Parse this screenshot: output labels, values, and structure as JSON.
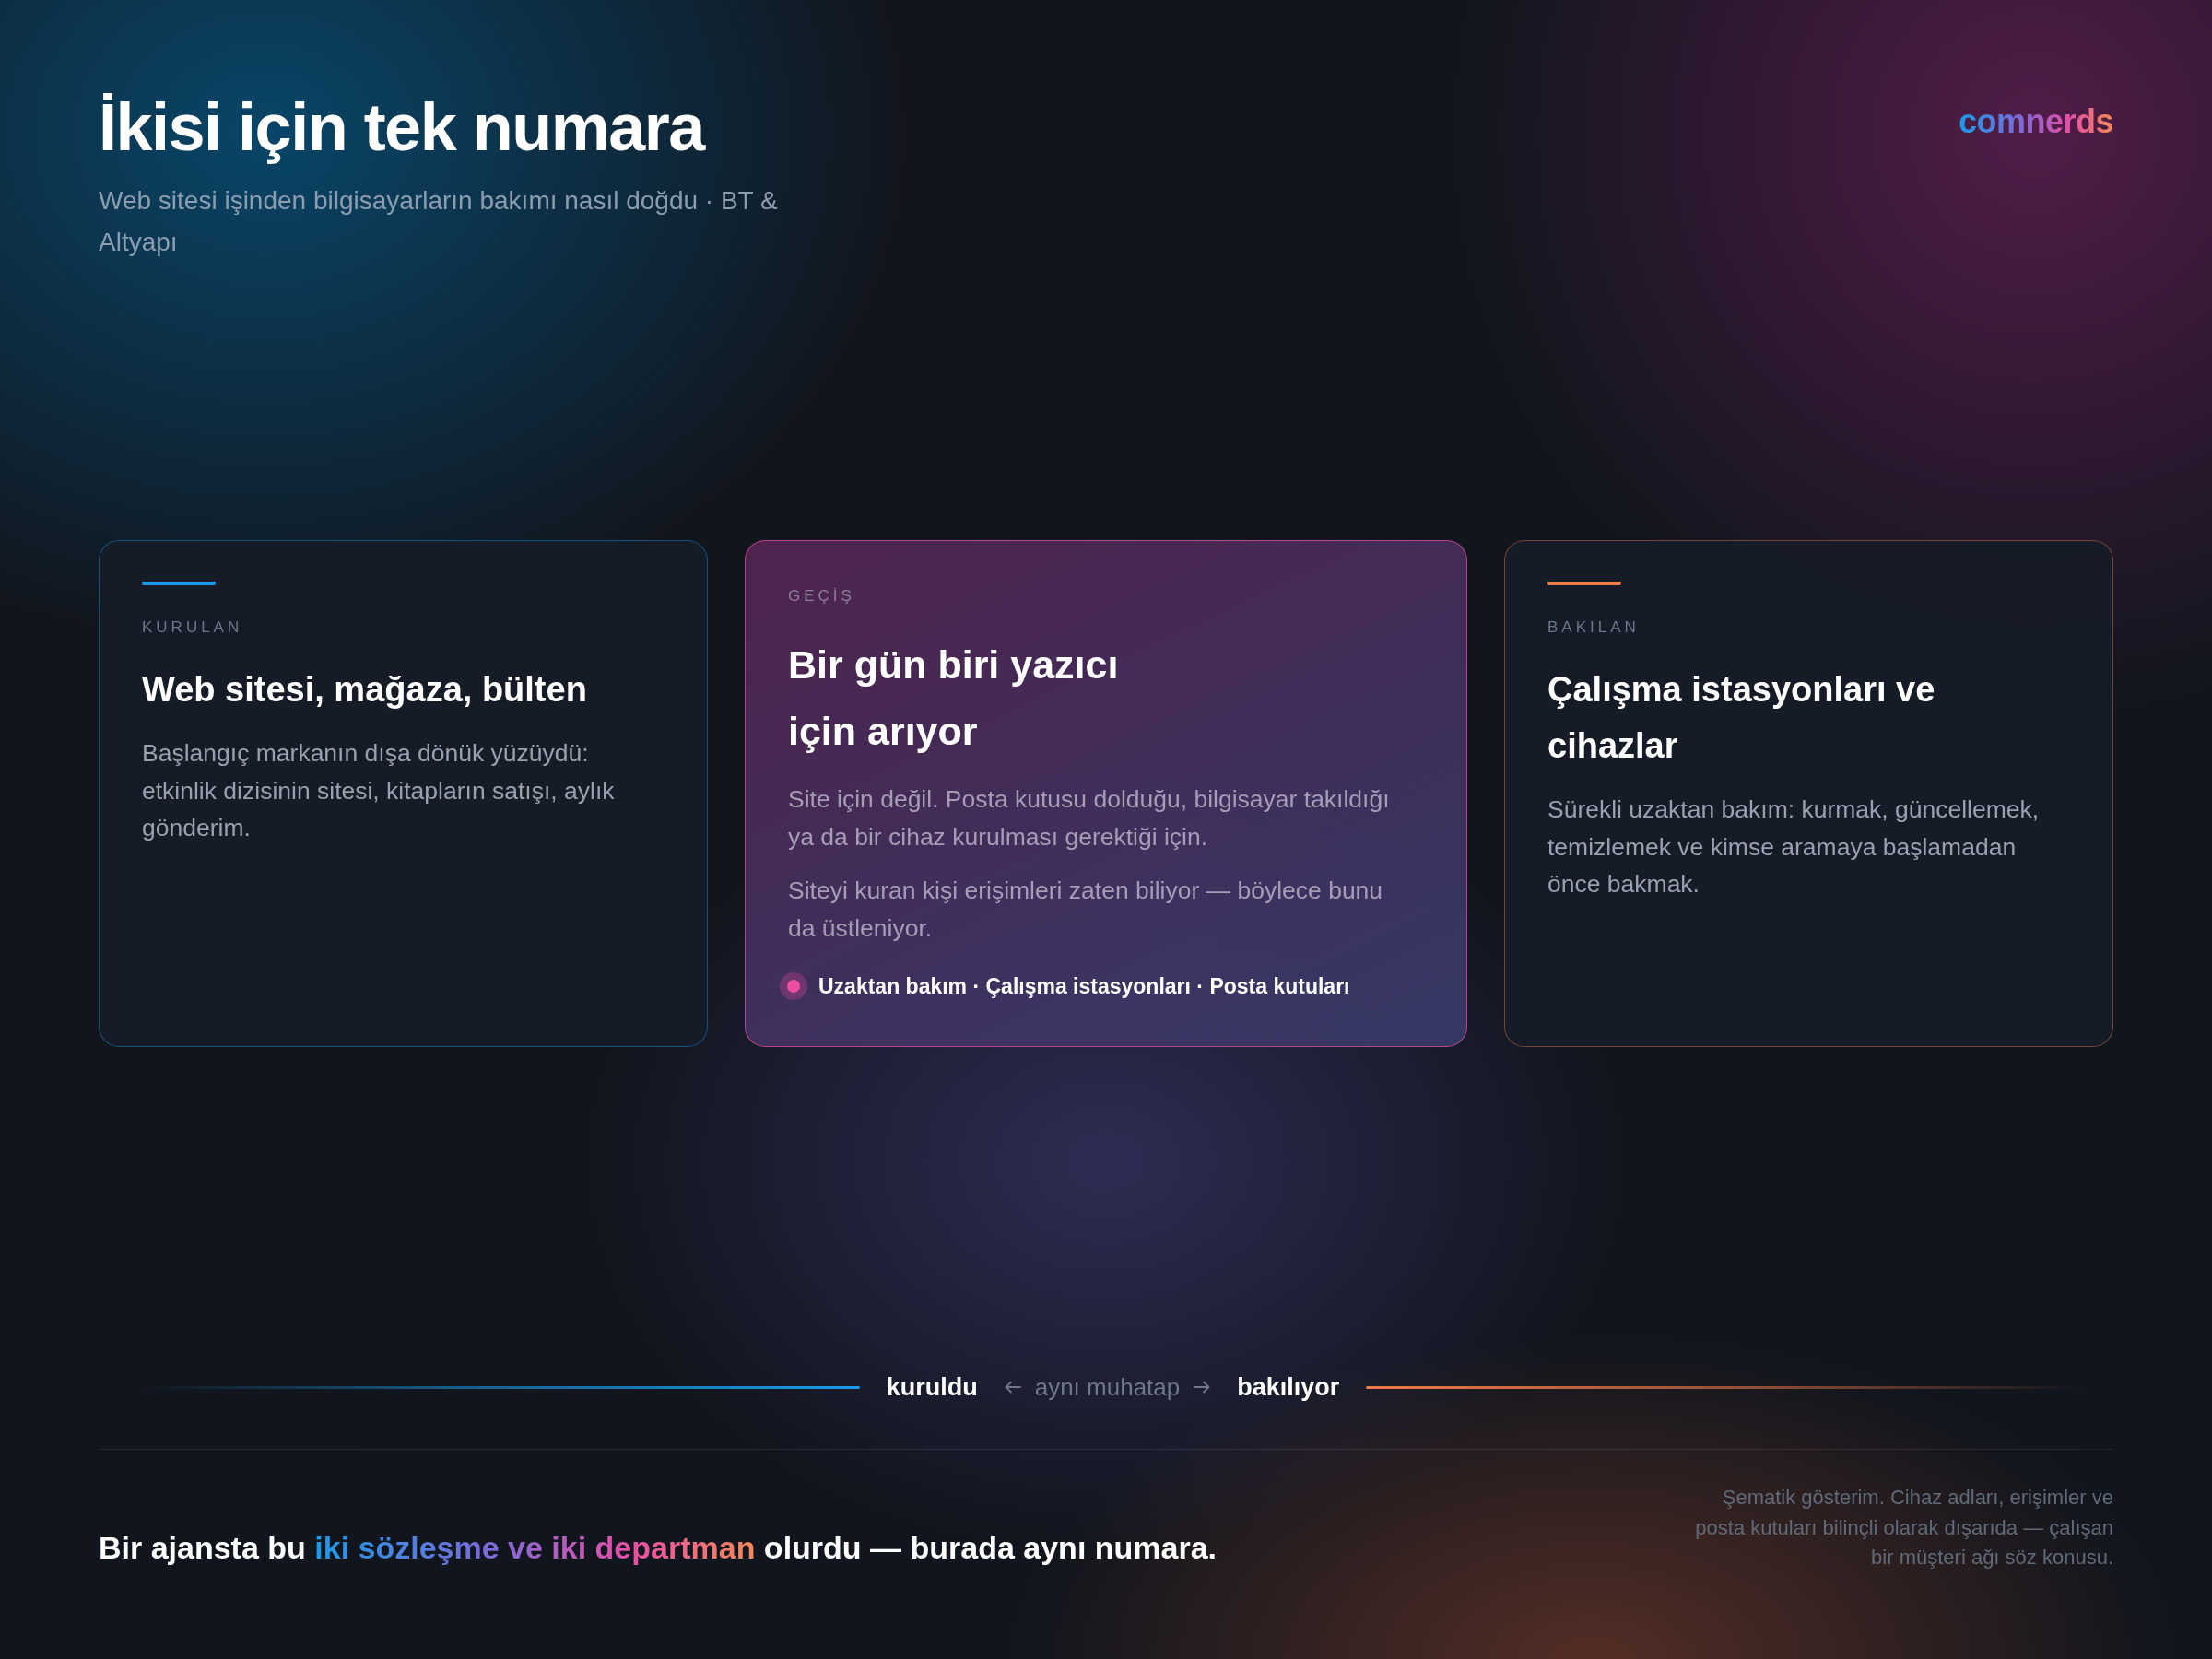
{
  "header": {
    "title": "İkisi için tek numara",
    "subtitle": "Web sitesi işinden bilgisayarların bakımı nasıl doğdu · BT & Altyapı"
  },
  "logo": "comnerds",
  "cards": [
    {
      "kind": "side",
      "color": "#1a9be8",
      "label": "KURULAN",
      "title": "Web sitesi, mağaza, bülten",
      "paragraphs": [
        "Başlangıç markanın dışa dönük yüzüydü: etkinlik dizisinin sitesi, kitapların satışı, aylık gönderim."
      ]
    },
    {
      "kind": "featured",
      "color": "#ec4fa2",
      "label": "GEÇİŞ",
      "title": "Bir gün biri yazıcı için arıyor",
      "paragraphs": [
        "Site için değil. Posta kutusu dolduğu, bilgisayar takıldığı ya da bir cihaz kurulması gerektiği için.",
        "Siteyi kuran kişi erişimleri zaten biliyor — böylece bunu da üstleniyor."
      ],
      "tags": "Uzaktan bakım · Çalışma istasyonları · Posta kutuları"
    },
    {
      "kind": "side",
      "color": "#f07a4a",
      "label": "BAKILAN",
      "title": "Çalışma istasyonları ve cihazlar",
      "paragraphs": [
        "Sürekli uzaktan bakım: kurmak, güncellemek, temizlemek ve kimse aramaya başlamadan önce bakmak."
      ]
    }
  ],
  "timeline": {
    "start": "kuruldu",
    "via": "aynı muhatap",
    "end": "bakılıyor"
  },
  "footer": {
    "statement": {
      "before": "Bir ajansta bu",
      "highlight": "iki sözleşme ve iki departman",
      "after": "olurdu — burada aynı numara."
    },
    "note": "Şematik gösterim. Cihaz adları, erişimler ve posta kutuları bilinçli olarak dışarıda — çalışan bir müşteri ağı söz konusu."
  }
}
